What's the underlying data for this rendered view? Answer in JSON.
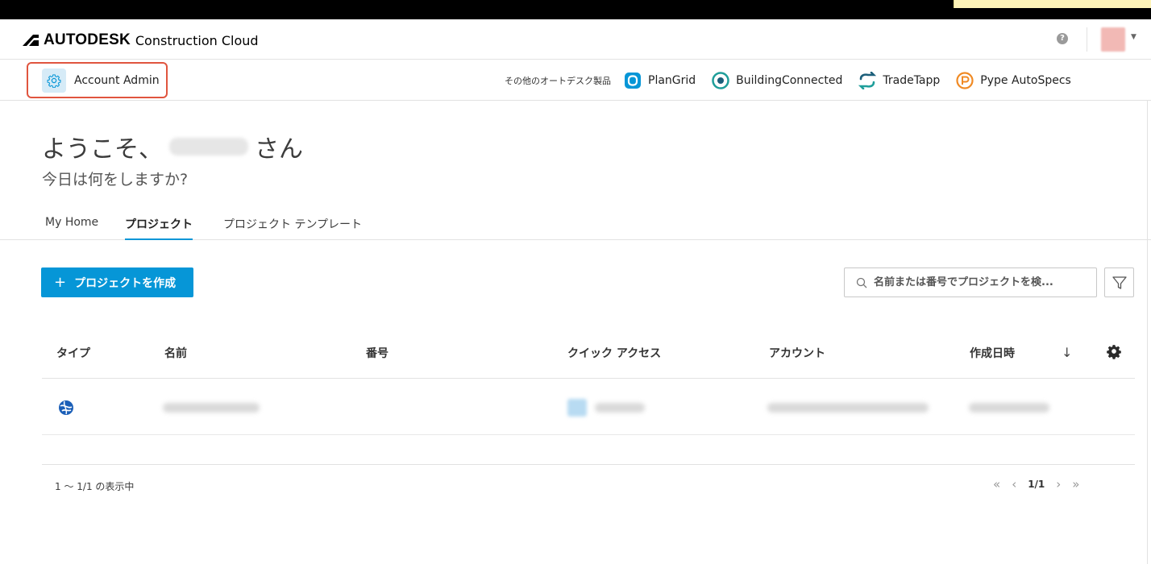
{
  "brand": {
    "strong": "AUTODESK",
    "light": "Construction Cloud"
  },
  "topbar": {
    "help_glyph": "?",
    "avatar_caret": "▼"
  },
  "subbar": {
    "account_admin_label": "Account Admin",
    "products_label": "その他のオートデスク製品",
    "products": [
      {
        "label": "PlanGrid",
        "icon": "plangrid-icon",
        "color": "#0696d7"
      },
      {
        "label": "BuildingConnected",
        "icon": "buildingconnected-icon",
        "color": "#1f9e9a"
      },
      {
        "label": "TradeTapp",
        "icon": "tradetapp-icon",
        "color": "#1c5f7a"
      },
      {
        "label": "Pype AutoSpecs",
        "icon": "pype-icon",
        "color": "#f08a24"
      }
    ]
  },
  "welcome": {
    "prefix": "ようこそ、",
    "suffix": "さん",
    "subtitle": "今日は何をしますか?"
  },
  "tabs": [
    {
      "label": "My Home",
      "active": false
    },
    {
      "label": "プロジェクト",
      "active": true
    },
    {
      "label": "プロジェクト テンプレート",
      "active": false
    }
  ],
  "actions": {
    "create_plus": "+",
    "create_label": "プロジェクトを作成",
    "search_placeholder": "名前または番号でプロジェクトを検..."
  },
  "table": {
    "columns": [
      "タイプ",
      "名前",
      "番号",
      "クイック アクセス",
      "アカウント",
      "作成日時"
    ],
    "sort_glyph": "↓"
  },
  "footer": {
    "count_text": "1 〜 1/1 の表示中",
    "first": "«",
    "prev": "‹",
    "page": "1/1",
    "next": "›",
    "last": "»"
  },
  "colors": {
    "accent": "#0696d7",
    "highlight": "#e0553f"
  }
}
